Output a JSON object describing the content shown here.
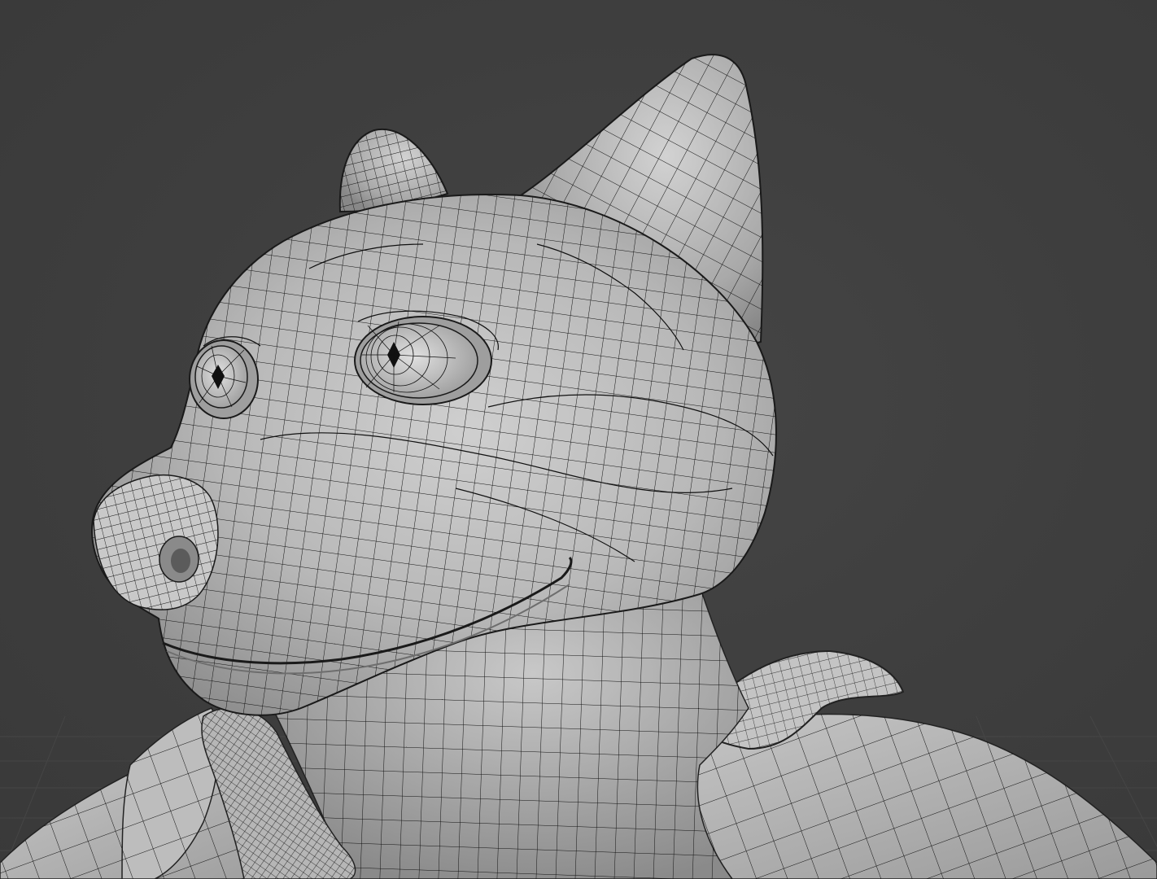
{
  "viewport": {
    "background_color": "#3d3d3d",
    "grid_color": "#4a4a4a",
    "mesh_color": "#bdbdbd",
    "wire_color": "#111111",
    "shading": "solid",
    "overlay": "wireframe"
  },
  "model": {
    "parts": [
      "head",
      "left-ear",
      "right-ear",
      "left-eye",
      "right-eye",
      "snout",
      "nose",
      "mouth",
      "neck",
      "jacket",
      "collar",
      "lapel",
      "tie"
    ]
  }
}
